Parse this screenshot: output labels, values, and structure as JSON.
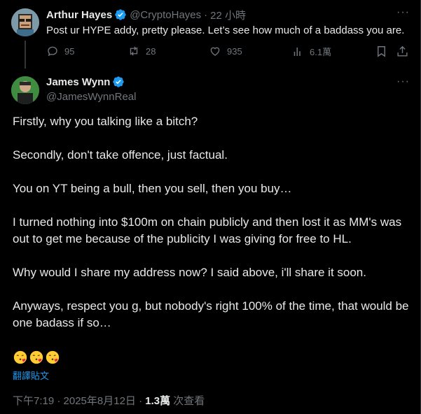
{
  "parent_tweet": {
    "author_name": "Arthur Hayes",
    "author_handle": "@CryptoHayes",
    "separator": "·",
    "time_ago": "22 小時",
    "more_label": "···",
    "text": "Post ur HYPE addy, pretty please. Let’s see how much of a baddass you are.",
    "stats": {
      "replies": "95",
      "reposts": "28",
      "likes": "935",
      "views": "6.1萬"
    },
    "icons": [
      "reply-icon",
      "repost-icon",
      "like-icon",
      "views-icon",
      "bookmark-icon",
      "share-icon"
    ]
  },
  "main_tweet": {
    "author_name": "James Wynn",
    "author_handle": "@JamesWynnReal",
    "more_label": "···",
    "paragraphs": [
      "Firstly, why you talking like a bitch?",
      "Secondly, don't take offence, just factual.",
      "You on YT being a bull, then you sell, then you buy…",
      "I turned nothing into $100m on chain publicly and then lost it as MM's was out to get me because of the publicity I was giving for free to HL.",
      "Why would I share my address now? I said above, i'll share it soon.",
      "Anyways, respect you g, but nobody's right 100% of the time, that would be one badass if so…"
    ],
    "emoji": [
      "face-blowing-a-kiss",
      "face-blowing-a-kiss",
      "face-blowing-a-kiss"
    ],
    "translate_label": "翻譯貼文",
    "timestamp": "下午7:19 · 2025年8月12日",
    "separator": " · ",
    "views_count": "1.3萬",
    "views_label": " 次查看"
  },
  "colors": {
    "background": "#000000",
    "text": "#e7e9ea",
    "muted": "#71767b",
    "accent": "#1d9bf0",
    "verified": "#1d9bf0"
  }
}
